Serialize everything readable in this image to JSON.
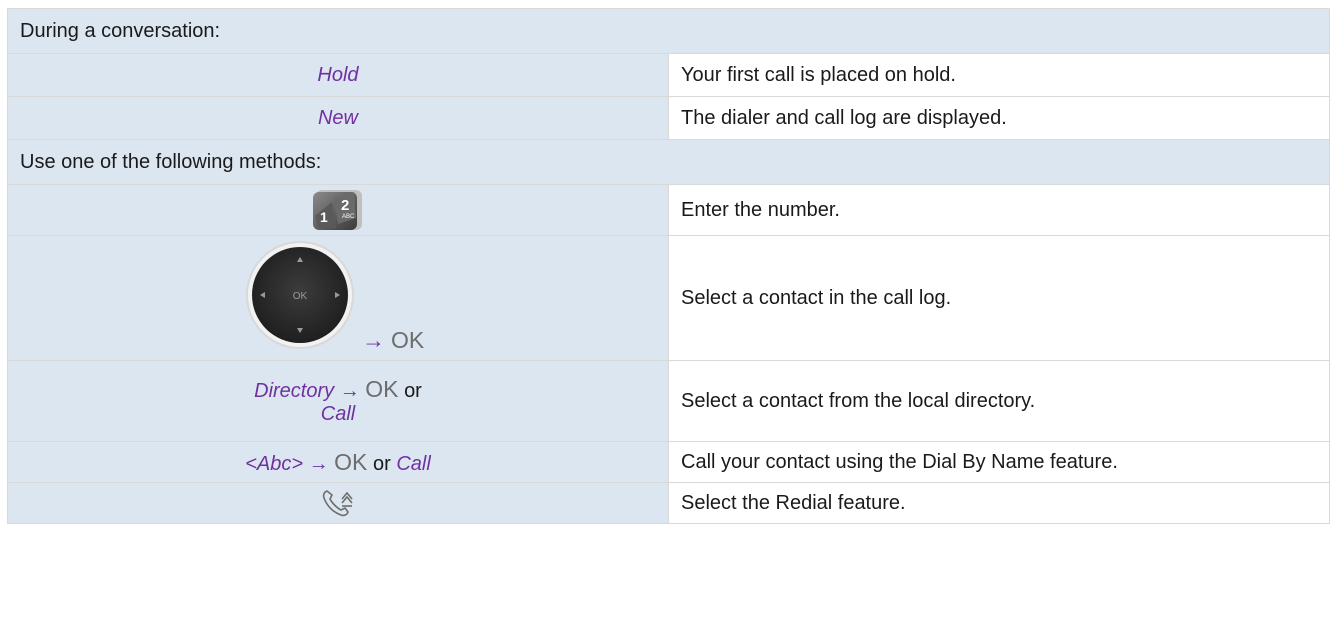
{
  "sections": [
    {
      "title": "During a conversation:"
    },
    {
      "title": "Use one of the following methods:"
    }
  ],
  "rows_conversation": [
    {
      "action": "Hold",
      "description": "Your first call is placed on hold."
    },
    {
      "action": "New",
      "description": "The dialer and call log are displayed."
    }
  ],
  "rows_methods": {
    "keypad": {
      "icon": "keypad-icon",
      "description": "Enter the number."
    },
    "navigator": {
      "icon": "navigator-icon",
      "arrow": "→",
      "ok": "OK",
      "center_label": "OK",
      "description": "Select a contact in the call log."
    },
    "directory": {
      "action": "Directory",
      "arrow": "→",
      "ok": "OK",
      "or": "or",
      "call": "Call",
      "description": "Select a contact from the local directory."
    },
    "abc": {
      "action": "<Abc>",
      "arrow": "→",
      "ok": "OK",
      "or": "or",
      "call": "Call",
      "description": "Call your contact using the Dial By Name feature."
    },
    "redial": {
      "icon": "redial-icon",
      "description": "Select the Redial feature."
    }
  },
  "colors": {
    "header_bg": "#dce6f1",
    "action_purple": "#7030a0",
    "border": "#d9d9d9"
  }
}
